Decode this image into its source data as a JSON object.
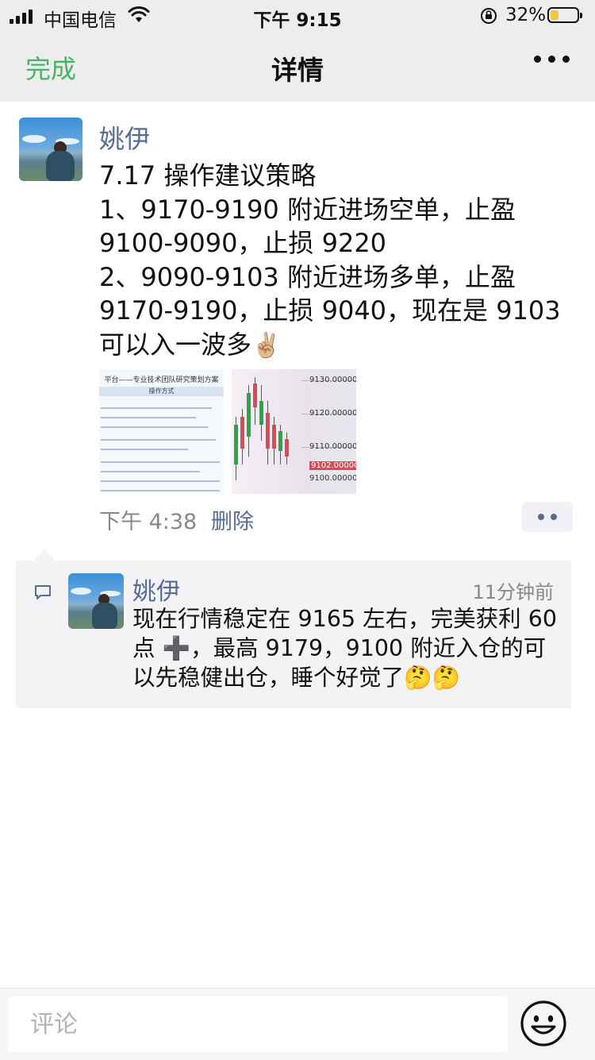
{
  "status_bar": {
    "carrier": "中国电信",
    "time": "下午 9:15",
    "battery_percent": "32%",
    "battery_level": 0.32,
    "battery_color": "#f3c53a"
  },
  "nav": {
    "done_label": "完成",
    "title": "详情",
    "more_icon": "more-dots-icon",
    "done_color": "#4ab366"
  },
  "post": {
    "author": "姚伊",
    "lines": [
      "7.17 操作建议策略",
      "1、9170-9190 附近进场空单，止盈",
      "9100-9090，止损 9220",
      "2、9090-9103 附近进场多单，止盈",
      "9170-9190，止损 9040，现在是 9103",
      "可以入一波多"
    ],
    "emoji": "✌🏼",
    "photo1": {
      "title": "平台——专业技术团队研究策划方案",
      "box": "操作方式"
    },
    "photo2": {
      "labels": [
        "9130.00000",
        "9120.00000",
        "9110.00000",
        "9102.000000",
        "9100.00000"
      ]
    },
    "time": "下午 4:38",
    "delete_label": "删除",
    "link_color": "#576b95"
  },
  "comment": {
    "author": "姚伊",
    "time": "11分钟前",
    "text": "现在行情稳定在 9165 左右，完美获利 60 点 ➕，最高 9179，9100 附近入仓的可以先稳健出仓，睡个好觉了🤔🤔"
  },
  "input": {
    "placeholder": "评论",
    "emoji_icon": "smiley-icon"
  }
}
